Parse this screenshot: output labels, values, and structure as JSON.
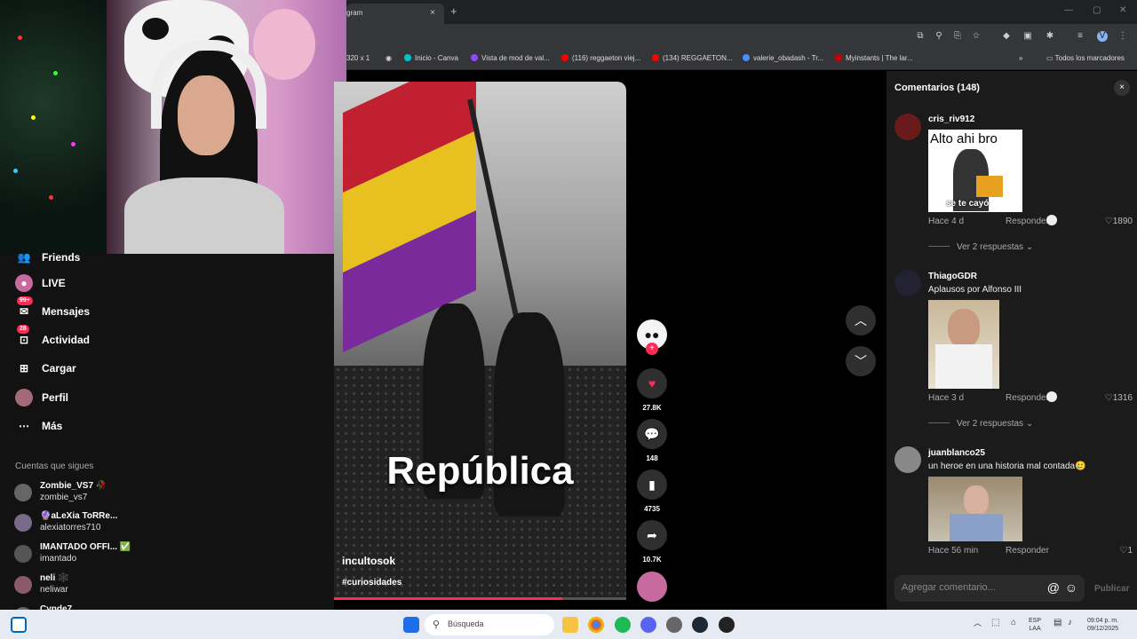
{
  "browser": {
    "tab_title": "gram",
    "tab_close": "×",
    "new_tab": "+",
    "url_fragment": "320 x 1",
    "bookmarks": [
      {
        "label": "Inicio - Canva",
        "color": "#00c4cc"
      },
      {
        "label": "Vista de mod de val...",
        "color": "#9146ff"
      },
      {
        "label": "(116) reggaeton viej...",
        "color": "#ff0000"
      },
      {
        "label": "(134) REGGAETON...",
        "color": "#ff0000"
      },
      {
        "label": "valerie_obadash - Tr...",
        "color": "#4a8cff"
      },
      {
        "label": "Myinstants | The lar...",
        "color": "#cc0000"
      }
    ],
    "more_bookmarks": "»",
    "all_bookmarks": "Todos los marcadores"
  },
  "sidebar": {
    "items": [
      {
        "label": "Friends",
        "badge": ""
      },
      {
        "label": "LIVE",
        "badge": ""
      },
      {
        "label": "Mensajes",
        "badge": "99+"
      },
      {
        "label": "Actividad",
        "badge": "28"
      },
      {
        "label": "Cargar",
        "badge": ""
      },
      {
        "label": "Perfil",
        "badge": ""
      },
      {
        "label": "Más",
        "badge": ""
      }
    ],
    "following_title": "Cuentas que sigues",
    "following": [
      {
        "name": "Zombie_VS7 🥀",
        "user": "zombie_vs7"
      },
      {
        "name": "🔮aLeXia ToRRe...",
        "user": "alexiatorres710"
      },
      {
        "name": "IMANTADO OFFI... ✅",
        "user": "imantado"
      },
      {
        "name": "neli 🕸️",
        "user": "neliwar"
      },
      {
        "name": "Cynde7",
        "user": ""
      }
    ]
  },
  "video": {
    "title": "República",
    "username": "incultosok",
    "hashtag": "#curiosidades",
    "progress": 0.78
  },
  "actions": {
    "likes": "27.8K",
    "comments": "148",
    "saves": "4735",
    "shares": "10.7K"
  },
  "comments_panel": {
    "title": "Comentarios (148)",
    "close": "×",
    "comments": [
      {
        "user": "cris_riv912",
        "text": "",
        "image_caption_top": "Alto ahi bro",
        "image_caption_bottom": "se te cayó",
        "time": "Hace 4 d",
        "reply": "Responder",
        "likes": "1890",
        "replies": "Ver 2 respuestas ⌄"
      },
      {
        "user": "ThiagoGDR",
        "text": "Aplausos por Alfonso III",
        "time": "Hace 3 d",
        "reply": "Responder",
        "likes": "1316",
        "replies": "Ver 2 respuestas ⌄"
      },
      {
        "user": "juanblanco25",
        "text": "un heroe en una historia mal contada🥲",
        "time": "Hace 56 min",
        "reply": "Responder",
        "likes": "1"
      }
    ],
    "input_placeholder": "Agregar comentario...",
    "publish": "Publicar"
  },
  "taskbar": {
    "search": "Búsqueda",
    "lang_top": "ESP",
    "lang_bottom": "LAA",
    "time": "09:04 p. m.",
    "date": "09/12/2025"
  }
}
